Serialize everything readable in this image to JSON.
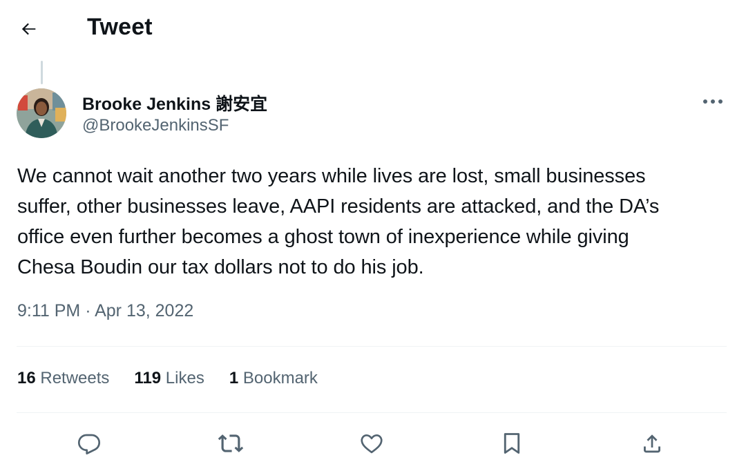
{
  "header": {
    "title": "Tweet",
    "back_icon": "arrow-left-icon"
  },
  "author": {
    "name": "Brooke Jenkins 謝安宜",
    "handle": "@BrookeJenkinsSF",
    "avatar_icon": "profile-photo"
  },
  "tweet": {
    "text": "We cannot wait another two years while lives are lost, small businesses\nsuffer, other businesses leave, AAPI residents are attacked, and the DA’s\noffice even further becomes a ghost town of inexperience while giving\nChesa Boudin our tax dollars not to do his job.",
    "time": "9:11 PM",
    "separator": " · ",
    "date": "Apr 13, 2022"
  },
  "stats": {
    "retweets_count": "16",
    "retweets_label": " Retweets",
    "likes_count": "119",
    "likes_label": " Likes",
    "bookmarks_count": "1",
    "bookmarks_label": " Bookmark"
  },
  "actions": [
    "reply-icon",
    "retweet-icon",
    "like-icon",
    "bookmark-icon",
    "share-icon"
  ],
  "colors": {
    "text": "#0f1419",
    "secondary": "#536471",
    "divider": "#eff3f4",
    "thread_line": "#cfd9de"
  }
}
